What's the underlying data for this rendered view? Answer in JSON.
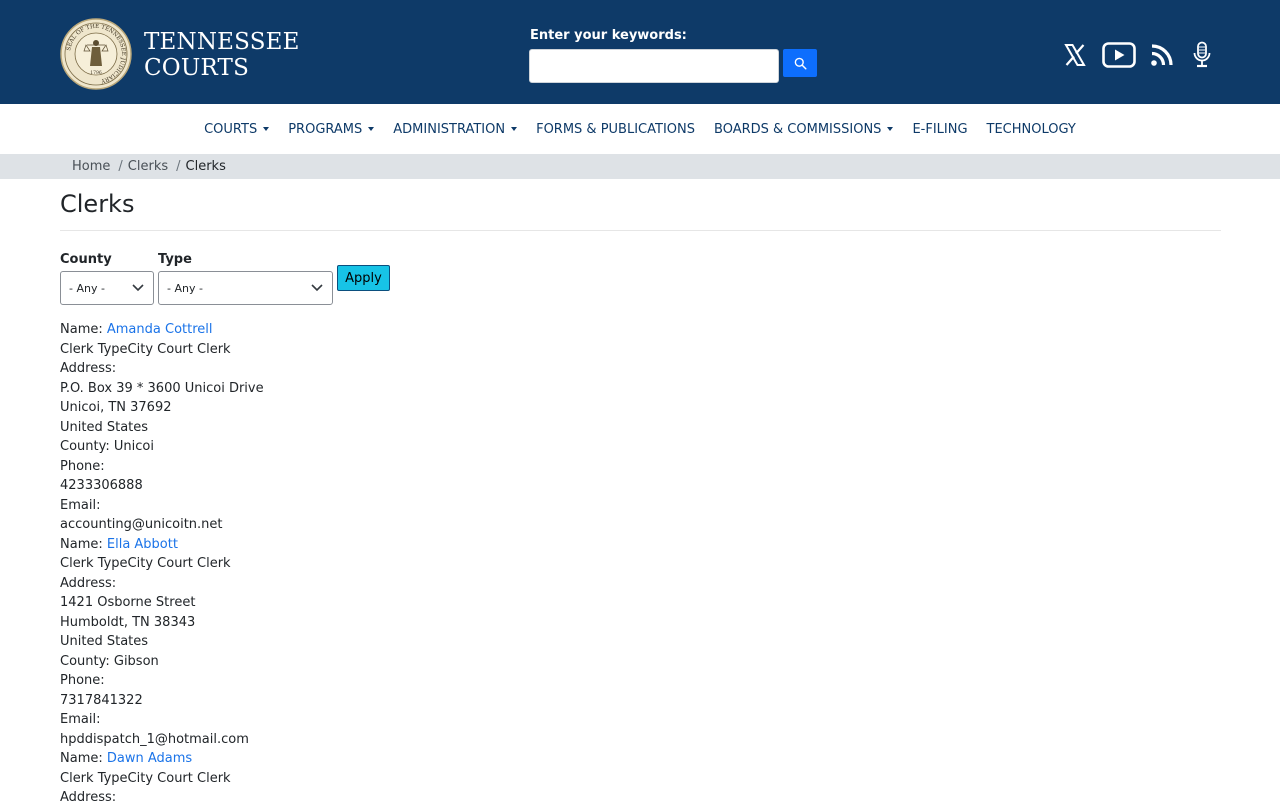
{
  "header": {
    "brand_line1": "TENNESSEE",
    "brand_line2": "COURTS",
    "search_label": "Enter your keywords:",
    "search_value": "",
    "seal_text": "SEAL OF THE TENNESSEE JUDICIARY",
    "seal_year": "1796"
  },
  "social": [
    "x-icon",
    "youtube-icon",
    "rss-icon",
    "podcast-icon"
  ],
  "nav": {
    "courts": "COURTS",
    "programs": "PROGRAMS",
    "administration": "ADMINISTRATION",
    "forms": "FORMS & PUBLICATIONS",
    "boards": "BOARDS & COMMISSIONS",
    "efiling": "E-FILING",
    "technology": "TECHNOLOGY"
  },
  "breadcrumb": {
    "home": "Home",
    "clerks": "Clerks",
    "current": "Clerks",
    "separator": "/"
  },
  "page_title": "Clerks",
  "filters": {
    "county_label": "County",
    "county_value": "- Any -",
    "type_label": "Type",
    "type_value": "- Any -",
    "apply_label": "Apply"
  },
  "clerks": [
    {
      "name_label": "Name:",
      "name": "Amanda Cottrell",
      "type_line": "Clerk TypeCity Court Clerk",
      "address_label": "Address:",
      "address1": "P.O. Box 39 * 3600 Unicoi Drive",
      "address2": "Unicoi, TN 37692",
      "country": "United States",
      "county": "County: Unicoi",
      "phone_label": "Phone:",
      "phone": "4233306888",
      "email_label": "Email:",
      "email": "accounting@unicoitn.net"
    },
    {
      "name_label": "Name:",
      "name": "Ella Abbott",
      "type_line": "Clerk TypeCity Court Clerk",
      "address_label": "Address:",
      "address1": "1421 Osborne Street",
      "address2": "Humboldt, TN 38343",
      "country": "United States",
      "county": "County: Gibson",
      "phone_label": "Phone:",
      "phone": "7317841322",
      "email_label": "Email:",
      "email": "hpddispatch_1@hotmail.com"
    },
    {
      "name_label": "Name:",
      "name": "Dawn Adams",
      "type_line": "Clerk TypeCity Court Clerk",
      "address_label": "Address:"
    }
  ],
  "colors": {
    "header_bg": "#0e3a68",
    "search_button": "#0d6efd",
    "apply_button": "#17c3e6",
    "link": "#1a73e8",
    "breadcrumb_bg": "#dee2e6"
  }
}
